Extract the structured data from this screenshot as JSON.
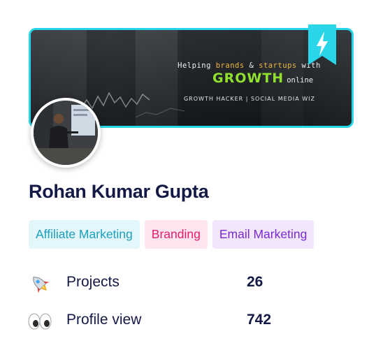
{
  "profile": {
    "name": "Rohan Kumar Gupta",
    "banner": {
      "tagline_prefix": "Helping ",
      "tagline_brands": "brands",
      "tagline_amp": " & ",
      "tagline_startups": "startups",
      "tagline_suffix": " with",
      "growth": "GROWTH",
      "online": "online",
      "subtitle": "GROWTH HACKER | SOCIAL MEDIA WIZ",
      "badge_icon": "lightning-bolt-icon"
    },
    "tags": [
      {
        "label": "Affiliate Marketing"
      },
      {
        "label": "Branding"
      },
      {
        "label": "Email Marketing"
      }
    ],
    "stats": [
      {
        "icon": "rocket-icon",
        "label": "Projects",
        "value": "26"
      },
      {
        "icon": "eyes-icon",
        "label": "Profile view",
        "value": "742"
      }
    ]
  },
  "colors": {
    "banner_border": "#27d5e8",
    "growth_green": "#8fe12d",
    "name_text": "#141a45",
    "tag_affiliate_text": "#1a9fbd",
    "tag_affiliate_bg": "#e3f6fc",
    "tag_branding_text": "#e31e70",
    "tag_branding_bg": "#fde4ee",
    "tag_email_text": "#7b2bd0",
    "tag_email_bg": "#f1e6fb"
  }
}
